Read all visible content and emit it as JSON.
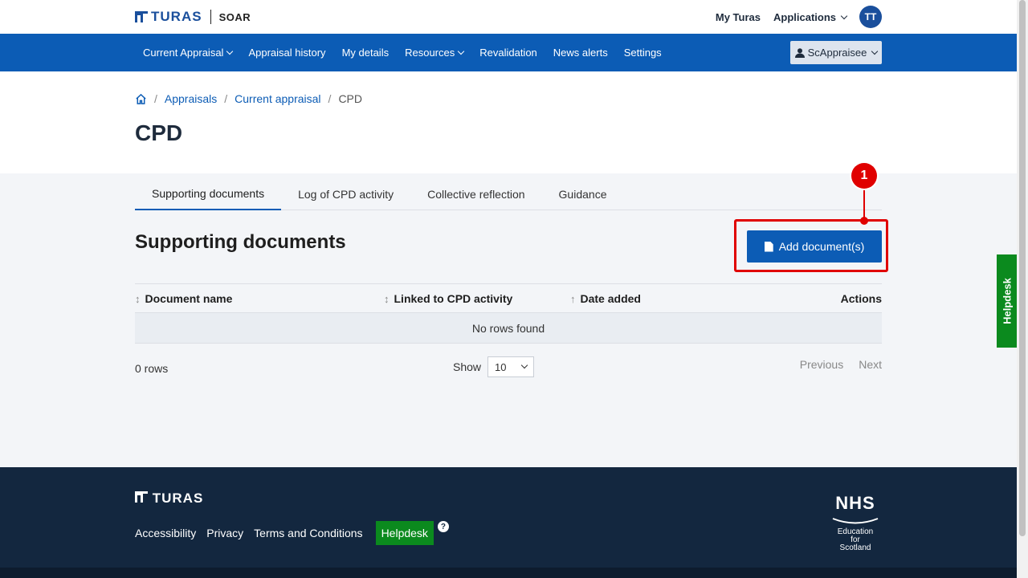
{
  "header": {
    "brand": "TURAS",
    "app_name": "SOAR",
    "my_turas": "My Turas",
    "applications": "Applications",
    "avatar_initials": "TT"
  },
  "nav": {
    "items": [
      "Current Appraisal",
      "Appraisal history",
      "My details",
      "Resources",
      "Revalidation",
      "News alerts",
      "Settings"
    ],
    "user": "ScAppraisee"
  },
  "breadcrumb": {
    "items": [
      "Appraisals",
      "Current appraisal"
    ],
    "current": "CPD"
  },
  "page_title": "CPD",
  "tabs": [
    "Supporting documents",
    "Log of CPD activity",
    "Collective reflection",
    "Guidance"
  ],
  "section_title": "Supporting documents",
  "add_button": "Add document(s)",
  "marker_number": "1",
  "table": {
    "columns": [
      "Document name",
      "Linked to CPD activity",
      "Date added",
      "Actions"
    ],
    "empty_message": "No rows found"
  },
  "pagination": {
    "rows_count": "0 rows",
    "show_label": "Show",
    "page_size": "10",
    "previous": "Previous",
    "next": "Next"
  },
  "footer": {
    "brand": "TURAS",
    "links": [
      "Accessibility",
      "Privacy",
      "Terms and Conditions"
    ],
    "helpdesk": "Helpdesk",
    "help_icon": "?",
    "nhs": "NHS",
    "nhs_sub": [
      "Education",
      "for",
      "Scotland"
    ]
  },
  "side_helpdesk": "Helpdesk",
  "colors": {
    "primary": "#0c5cb5",
    "footer": "#13273f",
    "helpdesk_green": "#0b8a1e",
    "annotation_red": "#e00000"
  }
}
